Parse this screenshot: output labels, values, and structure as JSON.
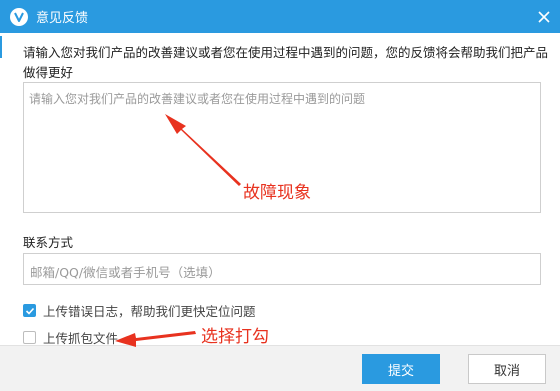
{
  "window": {
    "title": "意见反馈",
    "close_icon": "close-icon",
    "logo_icon": "app-logo-icon"
  },
  "form": {
    "prompt": "请输入您对我们产品的改善建议或者您在使用过程中遇到的问题，您的反馈将会帮助我们把产品做得更好",
    "feedback_placeholder": "请输入您对我们产品的改善建议或者您在使用过程中遇到的问题",
    "contact_label": "联系方式",
    "contact_placeholder": "邮箱/QQ/微信或者手机号（选填）",
    "checkboxes": [
      {
        "label": "上传错误日志，帮助我们更快定位问题",
        "checked": true
      },
      {
        "label": "上传抓包文件",
        "checked": false
      }
    ]
  },
  "footer": {
    "submit_label": "提交",
    "cancel_label": "取消"
  },
  "annotations": {
    "fault": "故障现象",
    "tick": "选择打勾"
  },
  "colors": {
    "accent": "#2a9ae0",
    "annotation": "#e8321f"
  }
}
